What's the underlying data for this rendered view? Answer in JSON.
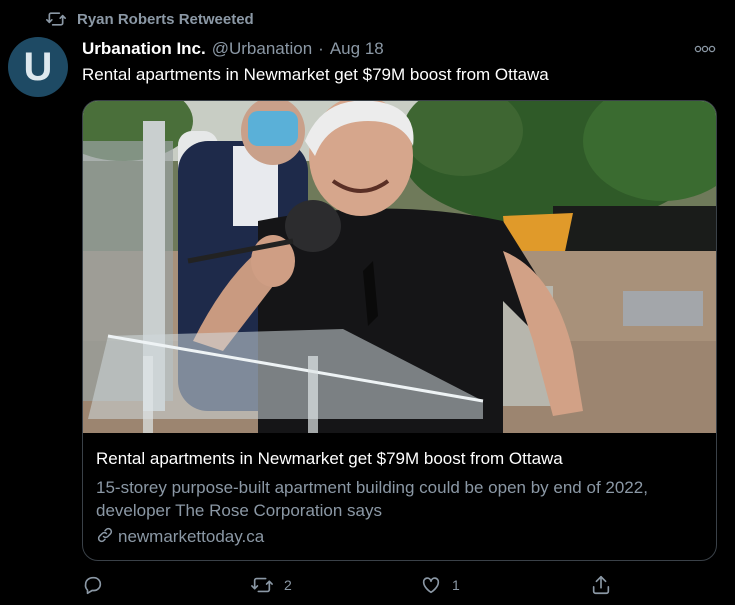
{
  "retweet": {
    "icon": "retweet-icon",
    "text": "Ryan Roberts Retweeted"
  },
  "author": {
    "avatar_letter": "U",
    "avatar_color": "#1e4a64",
    "name": "Urbanation Inc.",
    "handle": "@Urbanation",
    "separator": "·",
    "date": "Aug 18"
  },
  "tweet": {
    "text": "Rental apartments in Newmarket get $79M boost from Ottawa"
  },
  "card": {
    "image_icon": "press-conference-photo",
    "title": "Rental apartments in Newmarket get $79M boost from Ottawa",
    "description": "15-storey purpose-built apartment building could be open by end of 2022, developer The Rose Corporation says",
    "domain": "newmarkettoday.ca",
    "link_icon": "link-icon"
  },
  "actions": {
    "reply": {
      "icon": "reply-icon",
      "count": ""
    },
    "retweet": {
      "icon": "retweet-icon",
      "count": "2"
    },
    "like": {
      "icon": "heart-icon",
      "count": "1"
    },
    "share": {
      "icon": "share-icon",
      "count": ""
    }
  },
  "colors": {
    "background": "#000000",
    "text_primary": "#ffffff",
    "text_secondary": "#8b98a5",
    "card_border": "#3a4148"
  }
}
